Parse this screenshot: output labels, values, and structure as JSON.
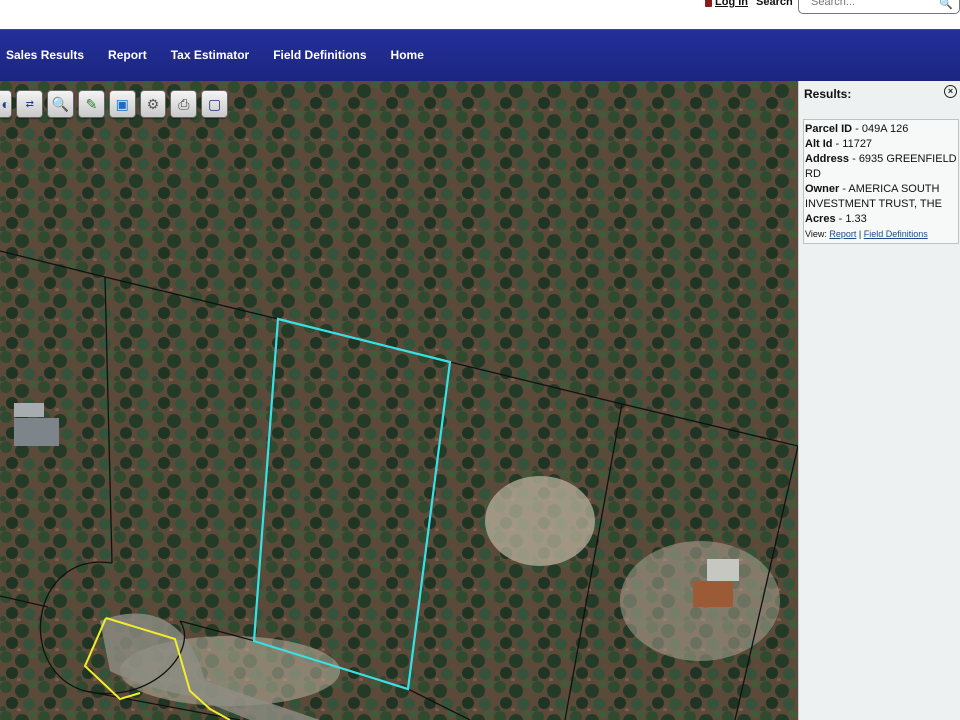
{
  "header": {
    "login_label": "Log In",
    "search_label": "Search",
    "search_placeholder": "Search..."
  },
  "nav": {
    "items": [
      "Sales Results",
      "Report",
      "Tax Estimator",
      "Field Definitions",
      "Home"
    ]
  },
  "toolbar": {
    "tools": [
      "globe-icon",
      "measure-icon",
      "zoom-icon",
      "pencil-icon",
      "select-icon",
      "settings-icon",
      "print-icon",
      "save-icon"
    ]
  },
  "results": {
    "title": "Results:",
    "parcel": {
      "parcel_id_label": "Parcel ID",
      "parcel_id": "049A 126",
      "alt_id_label": "Alt Id",
      "alt_id": "11727",
      "address_label": "Address",
      "address": "6935 GREENFIELD RD",
      "owner_label": "Owner",
      "owner": "AMERICA SOUTH INVESTMENT TRUST, THE",
      "acres_label": "Acres",
      "acres": "1.33",
      "view_label": "View:",
      "report_link": "Report",
      "field_definitions_link": "Field Definitions"
    }
  },
  "map": {
    "selected_parcel_color": "#39e0e6",
    "road_outline_color": "#f2ee2a",
    "parcel_line_color": "#111111"
  }
}
